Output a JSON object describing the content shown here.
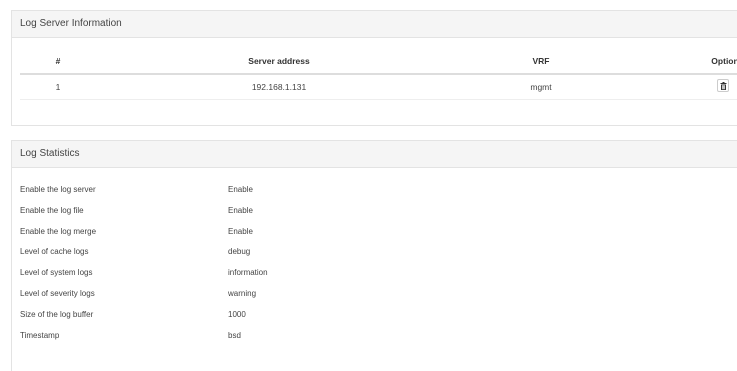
{
  "server_panel": {
    "title": "Log Server Information",
    "columns": [
      "#",
      "Server address",
      "VRF",
      "Option"
    ],
    "rows": [
      {
        "index": "1",
        "address": "192.168.1.131",
        "vrf": "mgmt",
        "option_icon": "trash-icon"
      }
    ]
  },
  "stats_panel": {
    "title": "Log Statistics",
    "items": [
      {
        "label": "Enable the log server",
        "value": "Enable"
      },
      {
        "label": "Enable the log file",
        "value": "Enable"
      },
      {
        "label": "Enable the log merge",
        "value": "Enable"
      },
      {
        "label": "Level of cache logs",
        "value": "debug"
      },
      {
        "label": "Level of system logs",
        "value": "information"
      },
      {
        "label": "Level of severity logs",
        "value": "warning"
      },
      {
        "label": "Size of the log buffer",
        "value": "1000"
      },
      {
        "label": "Timestamp",
        "value": "bsd"
      }
    ]
  },
  "colors": {
    "heading_bg": "#f5f5f5",
    "border": "#e3e3e3",
    "text": "#333333"
  }
}
